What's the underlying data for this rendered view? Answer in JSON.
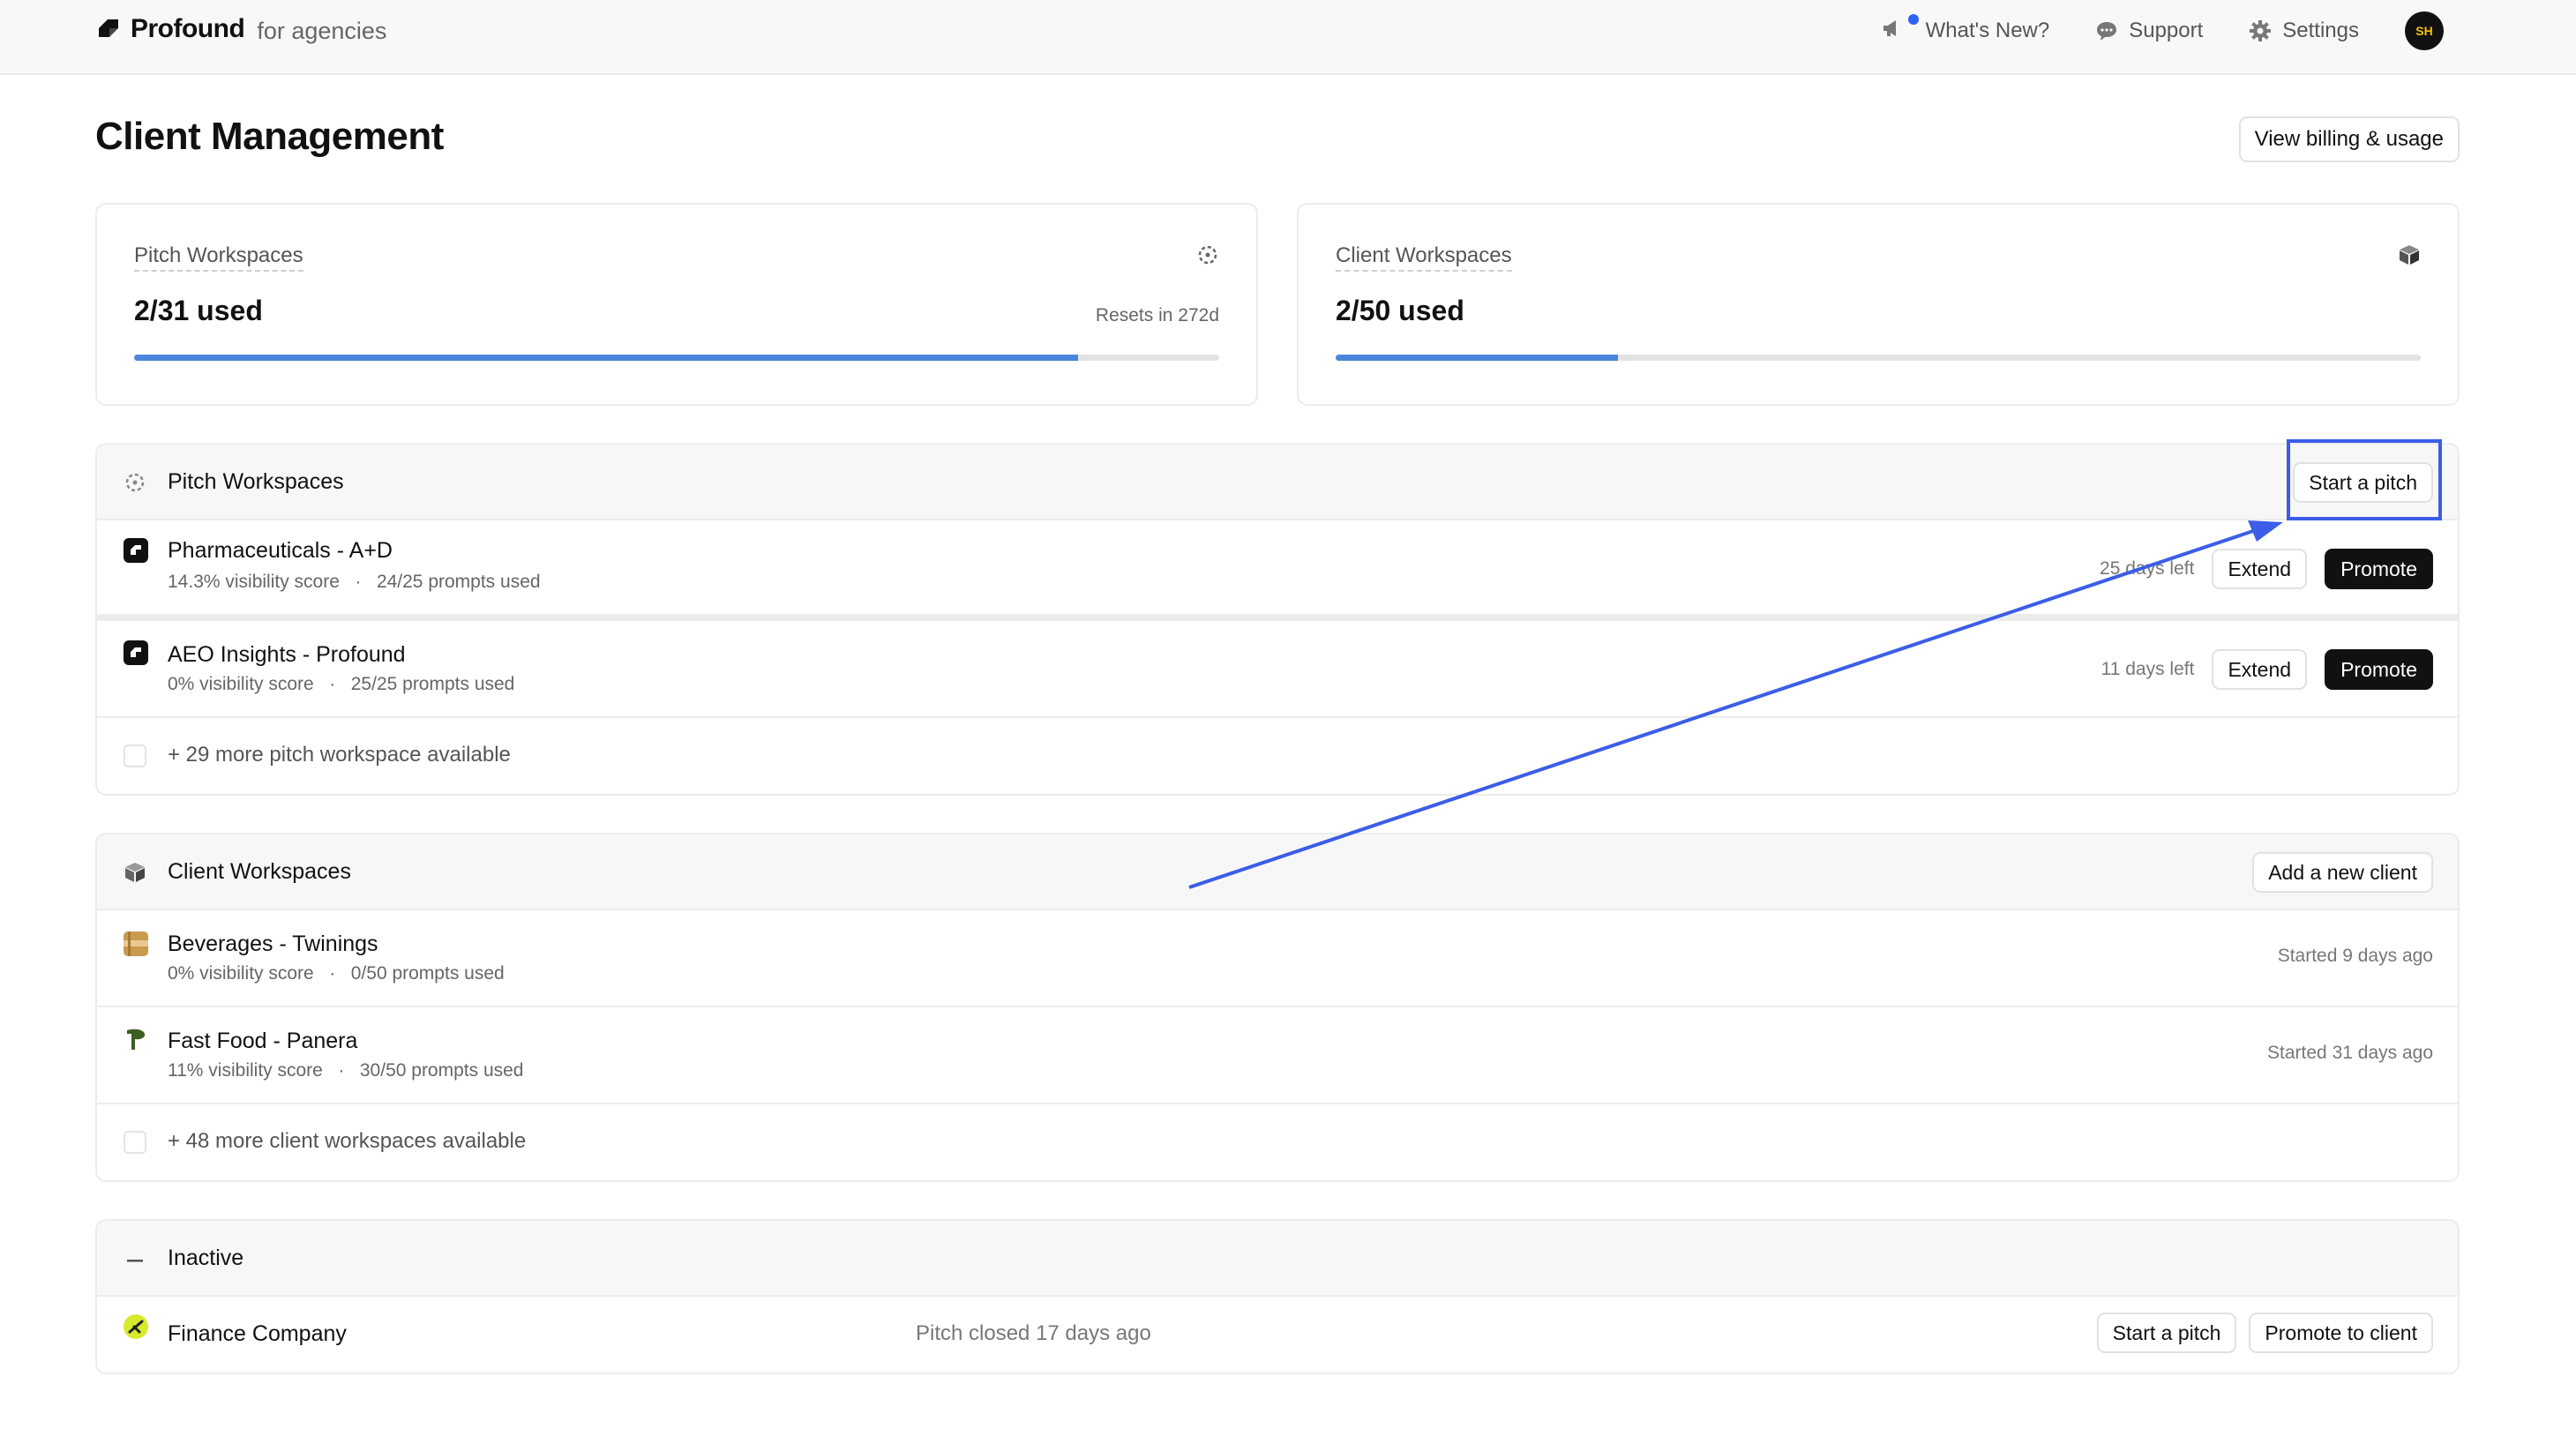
{
  "app": {
    "name": "Profound",
    "subtitle": "for agencies"
  },
  "nav": {
    "whats_new": "What's New?",
    "support": "Support",
    "settings": "Settings",
    "avatar_initials": "SH"
  },
  "page": {
    "title": "Client Management",
    "billing_button": "View billing & usage"
  },
  "stats": {
    "pitch": {
      "label": "Pitch Workspaces",
      "value": "2/31 used",
      "reset": "Resets in 272d",
      "progress": 0.87
    },
    "client": {
      "label": "Client Workspaces",
      "value": "2/50 used",
      "progress": 0.26
    }
  },
  "pitch_section": {
    "title": "Pitch Workspaces",
    "action": "Start a pitch",
    "rows": [
      {
        "name": "Pharmaceuticals - A+D",
        "score": "14.3% visibility score",
        "prompts": "24/25 prompts used",
        "days_left": "25 days left",
        "extend": "Extend",
        "promote": "Promote"
      },
      {
        "name": "AEO Insights - Profound",
        "score": "0% visibility score",
        "prompts": "25/25 prompts used",
        "days_left": "11 days left",
        "extend": "Extend",
        "promote": "Promote"
      }
    ],
    "more": "+ 29 more pitch workspace available"
  },
  "client_section": {
    "title": "Client Workspaces",
    "action": "Add a new client",
    "rows": [
      {
        "name": "Beverages - Twinings",
        "score": "0% visibility score",
        "prompts": "0/50 prompts used",
        "started": "Started 9 days ago"
      },
      {
        "name": "Fast Food - Panera",
        "score": "11% visibility score",
        "prompts": "30/50 prompts used",
        "started": "Started 31 days ago"
      }
    ],
    "more": "+ 48 more client workspaces available"
  },
  "inactive_section": {
    "title": "Inactive",
    "rows": [
      {
        "name": "Finance Company",
        "status": "Pitch closed 17 days ago",
        "start_pitch": "Start a pitch",
        "promote": "Promote to client"
      }
    ]
  },
  "colors": {
    "accent": "#3b5de7",
    "progress": "#4b86dc"
  },
  "meta_separator": "·"
}
